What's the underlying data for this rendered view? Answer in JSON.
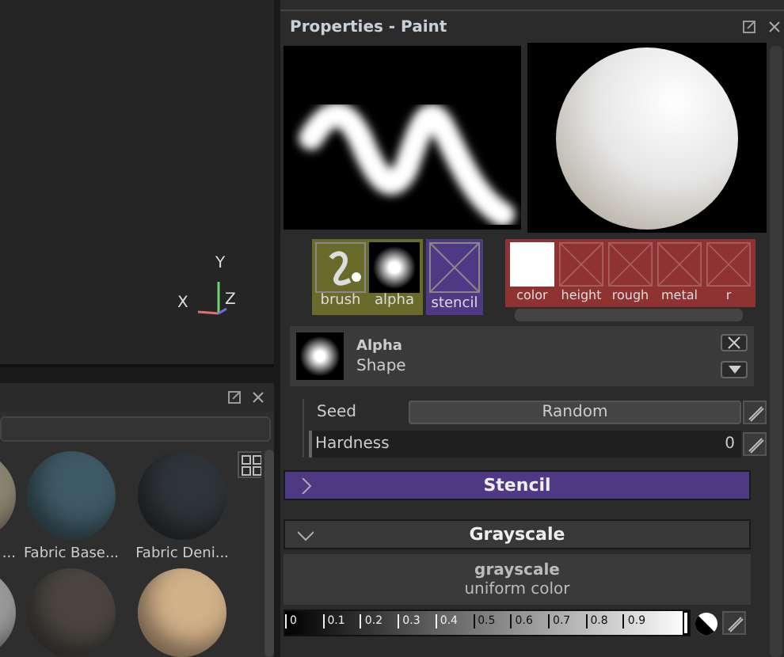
{
  "materials": {
    "items": [
      {
        "label": "...",
        "color": "#8a8470"
      },
      {
        "label": "Fabric Base...",
        "color": "#3e5a66"
      },
      {
        "label": "Fabric Deni...",
        "color": "#2f3438"
      },
      {
        "color": "#9a9a9a"
      },
      {
        "color": "#4a4540"
      },
      {
        "color": "#d2b088"
      }
    ]
  },
  "axes": {
    "x": "X",
    "y": "Y",
    "z": "Z"
  },
  "properties": {
    "title": "Properties - Paint",
    "brush_group": [
      {
        "label": "brush",
        "kind": "brush"
      },
      {
        "label": "alpha",
        "kind": "alpha"
      }
    ],
    "stencil": {
      "label": "stencil"
    },
    "channels": [
      {
        "label": "color",
        "kind": "swatch"
      },
      {
        "label": "height",
        "kind": "empty"
      },
      {
        "label": "rough",
        "kind": "empty"
      },
      {
        "label": "metal",
        "kind": "empty"
      },
      {
        "label": "r",
        "kind": "empty"
      }
    ],
    "alpha": {
      "title": "Alpha",
      "subtitle": "Shape"
    },
    "seed": {
      "label": "Seed",
      "value": "Random"
    },
    "hardness": {
      "label": "Hardness",
      "value": "0"
    },
    "sections": [
      {
        "title": "Stencil",
        "expanded": false
      },
      {
        "title": "Grayscale",
        "expanded": true
      }
    ],
    "grayscale": {
      "title": "grayscale",
      "subtitle": "uniform color",
      "ticks": [
        "0",
        "0.1",
        "0.2",
        "0.3",
        "0.4",
        "0.5",
        "0.6",
        "0.7",
        "0.8",
        "0.9"
      ],
      "level": 1
    }
  }
}
